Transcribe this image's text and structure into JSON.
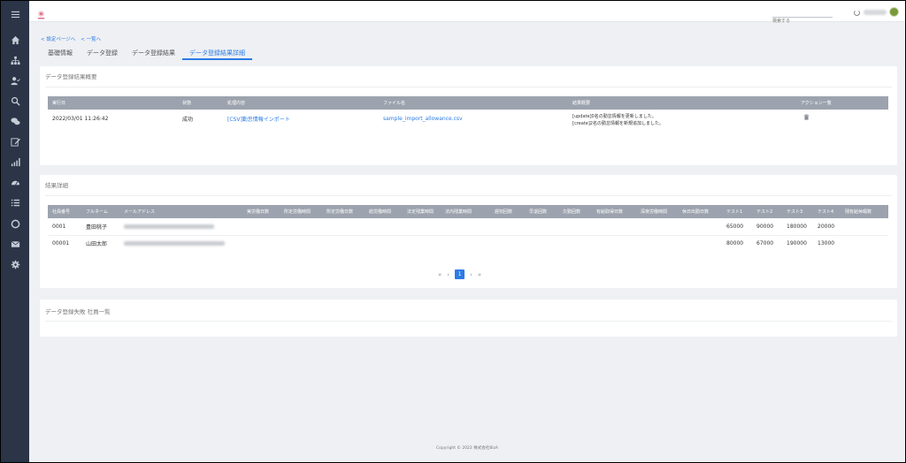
{
  "header": {
    "search_placeholder": "検索する"
  },
  "breadcrumb": {
    "back_settings": "< 設定ページへ",
    "back_list": "< 一覧へ"
  },
  "tabs": [
    {
      "label": "基礎情報"
    },
    {
      "label": "データ登録"
    },
    {
      "label": "データ登録結果"
    },
    {
      "label": "データ登録結果詳細",
      "active": true
    }
  ],
  "summary": {
    "title": "データ登録結果概要",
    "columns": [
      "実行日",
      "状態",
      "処理内容",
      "ファイル名",
      "結果概要",
      "アクション一覧"
    ],
    "row": {
      "date": "2022/03/01 11:26:42",
      "status": "成功",
      "process": "[CSV]勤怠情報インポート",
      "filename": "sample_import_allowance.csv",
      "result_line1": "[update]0名の勤怠情報を更新しました。",
      "result_line2": "[create]2名の勤怠情報を新規追加しました。"
    }
  },
  "details": {
    "title": "結果詳細",
    "columns": [
      "社員番号",
      "フルネーム",
      "メールアドレス",
      "実労働日数",
      "所定労働時間",
      "所定労働日数",
      "総労働時間",
      "法定残業時間",
      "法内残業時間",
      "遅刻回数",
      "早退回数",
      "欠勤回数",
      "有給取得日数",
      "深夜労働時間",
      "休日出勤日数",
      "テスト1",
      "テスト2",
      "テスト3",
      "テスト4",
      "残有給休暇数"
    ],
    "rows": [
      {
        "id": "0001",
        "name": "豊田桃子",
        "t1": "65000",
        "t2": "90000",
        "t3": "180000",
        "t4": "20000"
      },
      {
        "id": "00001",
        "name": "山田太郎",
        "t1": "80000",
        "t2": "67000",
        "t3": "190000",
        "t4": "13000"
      }
    ],
    "pager": {
      "first": "«",
      "prev": "‹",
      "current": "1",
      "next": "›",
      "last": "»"
    }
  },
  "failures": {
    "title": "データ登録失敗 社員一覧"
  },
  "footer": {
    "copyright": "Copyright © 2022 株式会社BizA"
  },
  "colors": {
    "accent": "#2c7be5",
    "sidebar": "#2b3547",
    "table_header": "#9da3ae"
  }
}
